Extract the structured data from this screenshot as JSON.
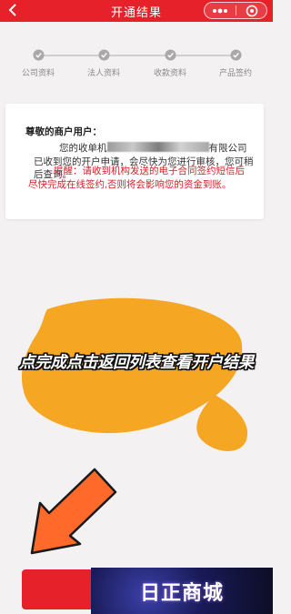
{
  "header": {
    "title": "开通结果",
    "back_icon": "chevron-left-icon",
    "more_icon": "more-dots-icon",
    "close_icon": "target-close-icon",
    "bg_color": "#e6212a"
  },
  "steps": [
    {
      "label": "公司资料",
      "status": "done"
    },
    {
      "label": "法人资料",
      "status": "done"
    },
    {
      "label": "收款资料",
      "status": "done"
    },
    {
      "label": "产品签约",
      "status": "done"
    }
  ],
  "card": {
    "greeting": "尊敬的商户用户：",
    "message_prefix": "您的收单机",
    "message_suffix": "有限公司已收到您的开户申请，会尽快为您进行审核，您可稍后查询。",
    "reminder": "提醒：请收到机构发送的电子合同签约短信后尽快完成在线签约,否则将会影响您的资金到账。"
  },
  "annotation": {
    "text": "点完成点击返回列表查看开户结果"
  },
  "bottom": {
    "button_color": "#e6212a"
  },
  "watermark": {
    "text": "日正商城"
  },
  "colors": {
    "accent": "#e6212a",
    "step_check": "#a9a9a9",
    "reminder": "#d7202a",
    "highlight": "#f5a623",
    "arrow": "#ff6a2a"
  }
}
